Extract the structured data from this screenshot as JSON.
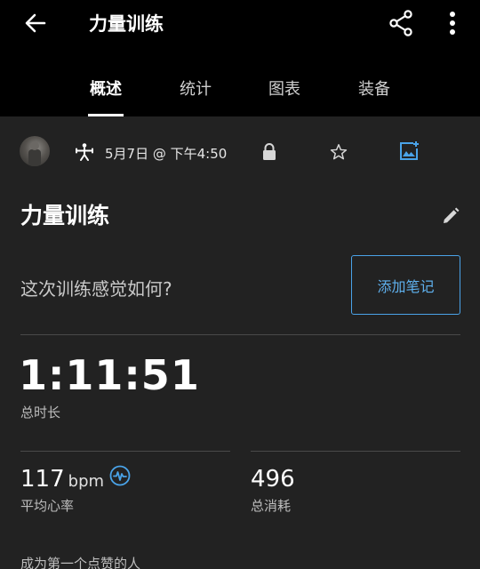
{
  "header": {
    "title": "力量训练",
    "icons": {
      "back": "arrow-left-icon",
      "share": "share-icon",
      "more": "more-vertical-icon"
    }
  },
  "tabs": [
    {
      "label": "概述",
      "active": true
    },
    {
      "label": "统计",
      "active": false
    },
    {
      "label": "图表",
      "active": false
    },
    {
      "label": "装备",
      "active": false
    }
  ],
  "meta": {
    "date_time": "5月7日 @ 下午4:50",
    "icons": {
      "avatar": "avatar",
      "activity": "strength-training-icon",
      "lock": "lock-icon",
      "star": "star-outline-icon",
      "add_photo": "add-photo-icon"
    }
  },
  "activity": {
    "name": "力量训练",
    "feel_prompt": "这次训练感觉如何?",
    "add_note_label": "添加笔记"
  },
  "stats": {
    "duration": {
      "value": "1:11:51",
      "label": "总时长"
    },
    "heart_rate": {
      "value": "117",
      "unit": "bpm",
      "label": "平均心率"
    },
    "calories": {
      "value": "496",
      "label": "总消耗"
    }
  },
  "social": {
    "like_prompt": "成为第一个点赞的人"
  },
  "colors": {
    "background": "#222222",
    "appbar": "#000000",
    "accent": "#4aa3e8"
  }
}
